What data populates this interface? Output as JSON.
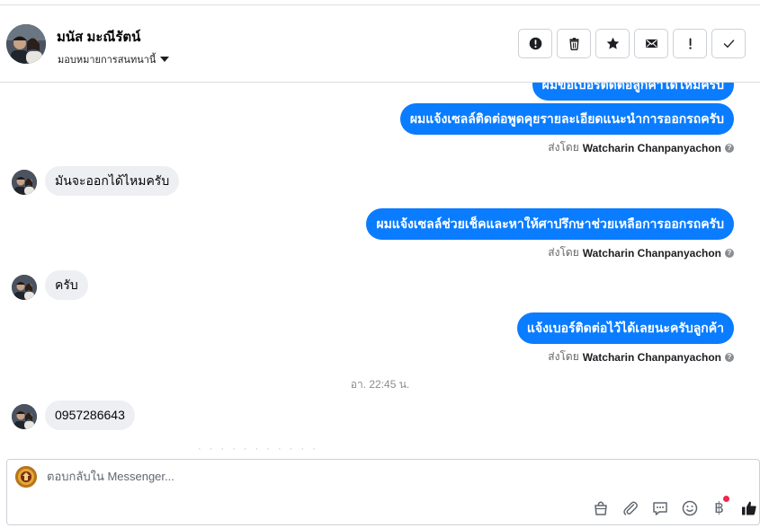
{
  "header": {
    "contact_name": "มนัส มะณีรัตน์",
    "assign_label": "มอบหมายการสนทนานี้"
  },
  "toolbar": {
    "buttons": [
      {
        "name": "spam",
        "icon": "exclamation-circle-icon"
      },
      {
        "name": "delete",
        "icon": "trash-icon"
      },
      {
        "name": "star",
        "icon": "star-icon"
      },
      {
        "name": "mark-unread",
        "icon": "envelope-icon"
      },
      {
        "name": "follow-up",
        "icon": "exclamation-icon"
      },
      {
        "name": "done",
        "icon": "check-icon"
      }
    ]
  },
  "messages": [
    {
      "type": "outgoing",
      "text": "ผมขอเบอร์ติดต่อลูกค้าได้ไหมครับ"
    },
    {
      "type": "outgoing",
      "text": "ผมแจ้งเซลล์ติดต่อพูดคุยรายละเอียดแนะนำการออกรถครับ"
    },
    {
      "type": "sent_by",
      "prefix": "ส่งโดย",
      "name": "Watcharin Chanpanyachon"
    },
    {
      "type": "incoming",
      "text": "มันจะออกได้ไหมครับ"
    },
    {
      "type": "outgoing",
      "text": "ผมแจ้งเซลล์ช่วยเช็คและหาให้ศาปรึกษาช่วยเหลือการออกรถครับ"
    },
    {
      "type": "sent_by",
      "prefix": "ส่งโดย",
      "name": "Watcharin Chanpanyachon"
    },
    {
      "type": "incoming",
      "text": "ครับ"
    },
    {
      "type": "outgoing",
      "text": "แจ้งเบอร์ติดต่อไว้ได้เลยนะครับลูกค้า"
    },
    {
      "type": "sent_by",
      "prefix": "ส่งโดย",
      "name": "Watcharin Chanpanyachon"
    },
    {
      "type": "timestamp",
      "text": "อา. 22:45 น."
    },
    {
      "type": "incoming",
      "text": "0957286643"
    }
  ],
  "reply": {
    "placeholder": "ตอบกลับใน Messenger..."
  },
  "reply_tools": [
    {
      "name": "shop",
      "icon": "shopping-bag-icon"
    },
    {
      "name": "attach",
      "icon": "paperclip-icon"
    },
    {
      "name": "saved-replies",
      "icon": "speech-bubble-icon"
    },
    {
      "name": "emoji",
      "icon": "smiley-icon"
    },
    {
      "name": "payment",
      "icon": "baht-icon",
      "symbol": "฿"
    },
    {
      "name": "like",
      "icon": "thumbs-up-icon"
    }
  ],
  "colors": {
    "outgoing_bubble": "#0a7cff",
    "incoming_bubble": "#eeeff2",
    "notification_dot": "#f02849"
  }
}
